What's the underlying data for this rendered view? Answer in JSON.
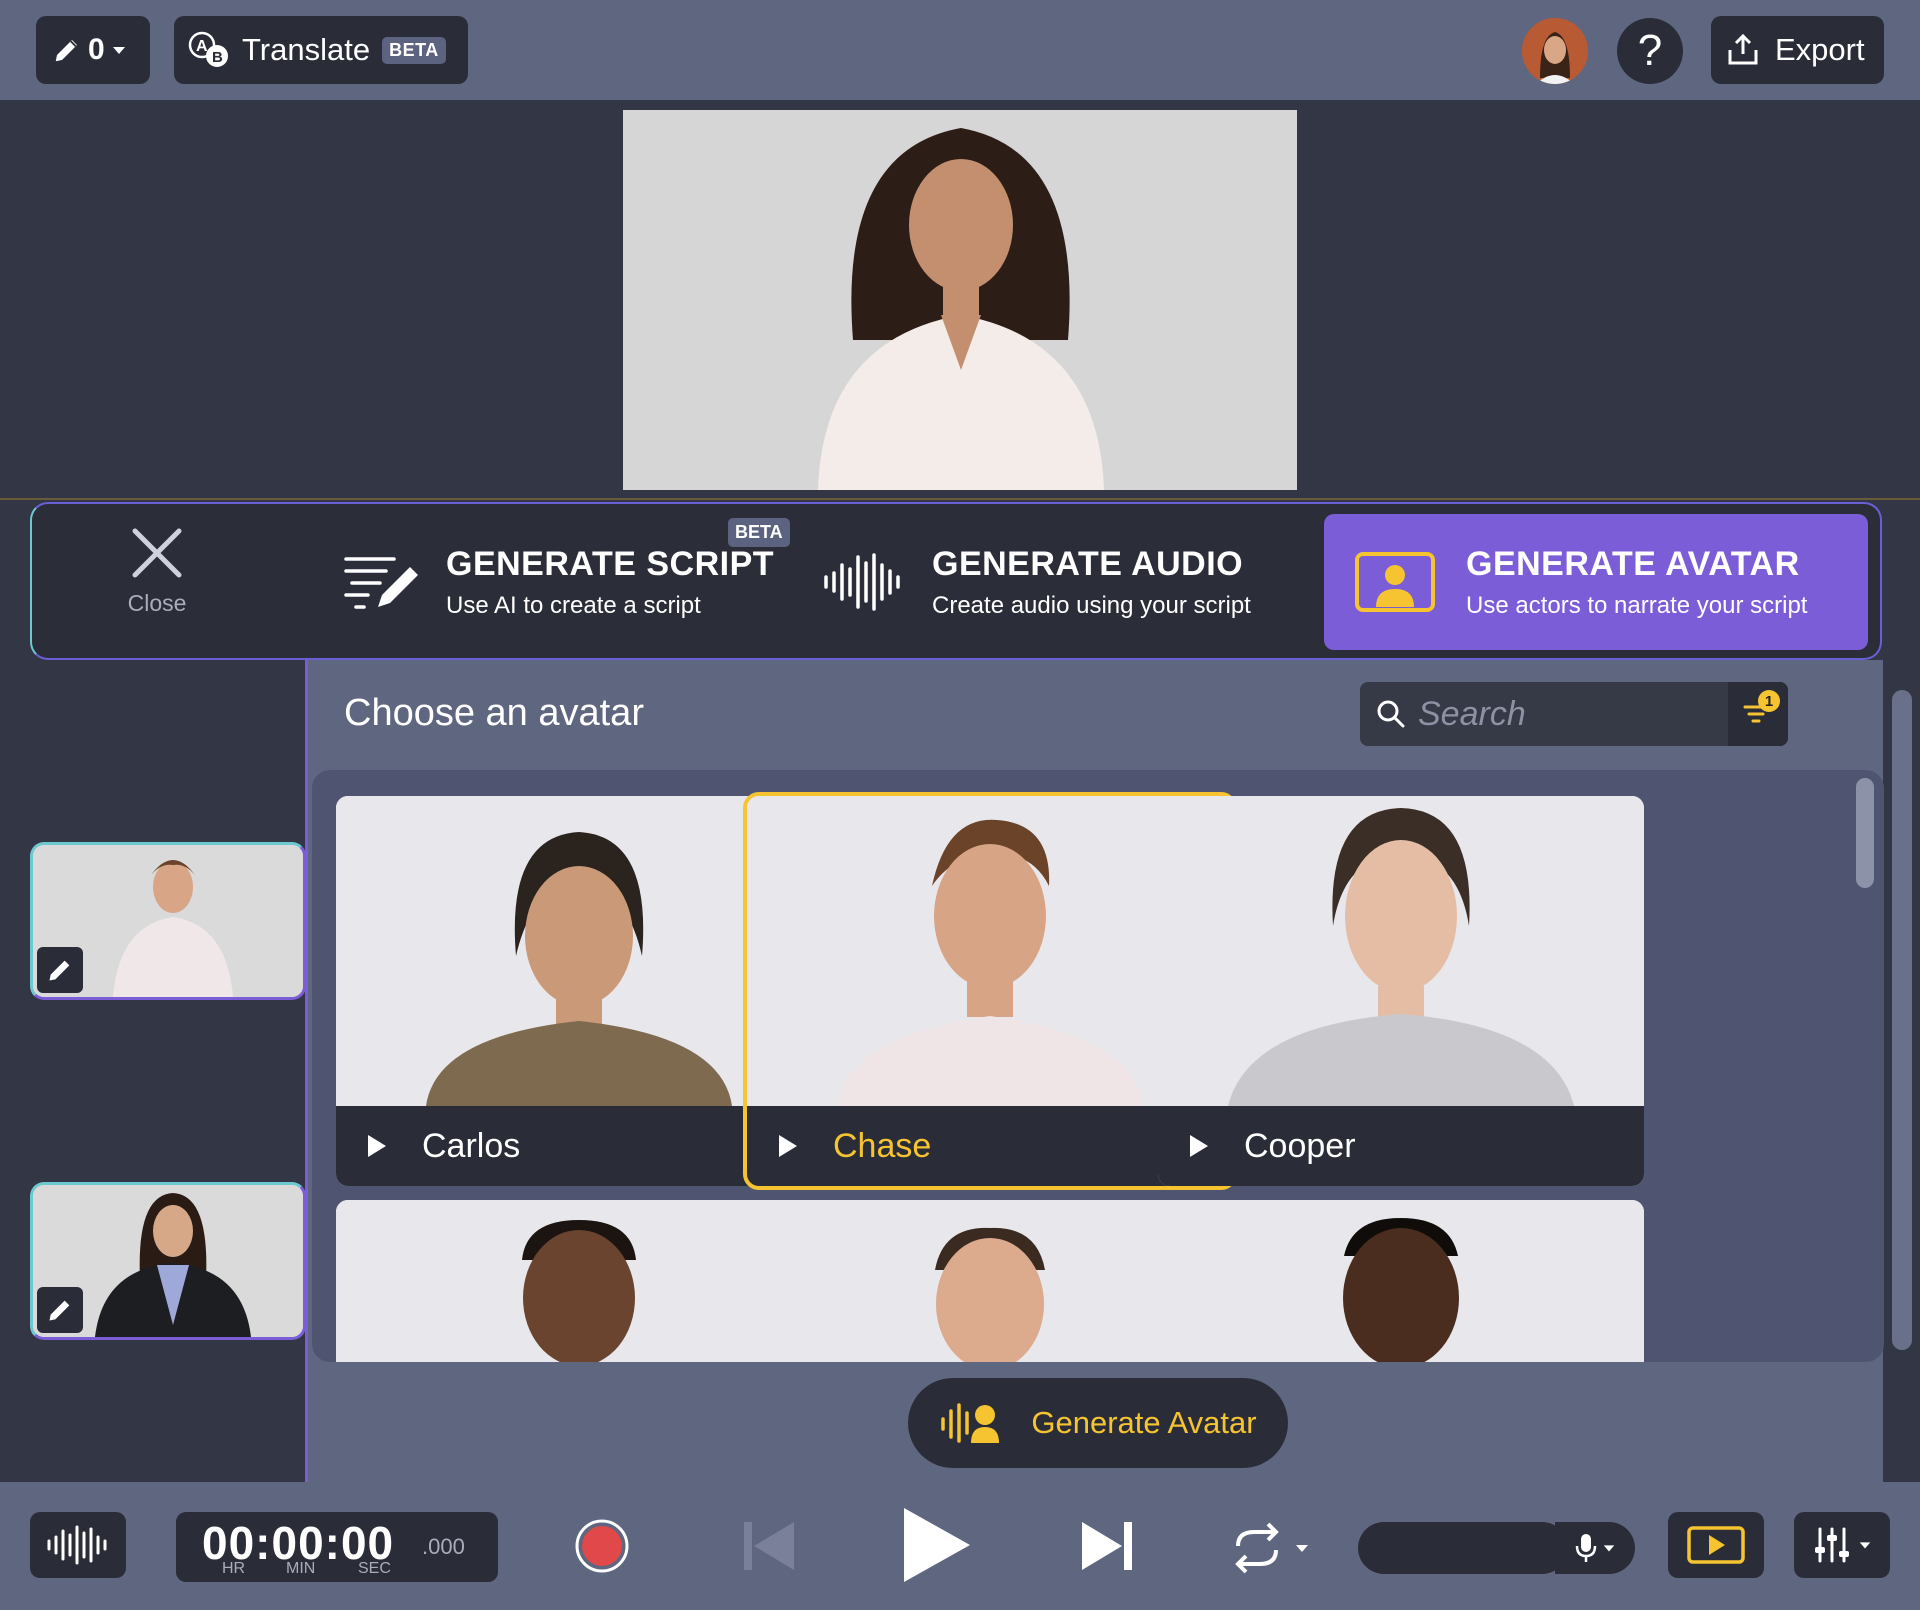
{
  "topbar": {
    "edit_count": "0",
    "translate_label": "Translate",
    "translate_badge": "BETA",
    "help_label": "?",
    "export_label": "Export"
  },
  "generate_panel": {
    "close_label": "Close",
    "tabs": [
      {
        "title": "GENERATE SCRIPT",
        "subtitle": "Use AI to create a script",
        "badge": "BETA"
      },
      {
        "title": "GENERATE AUDIO",
        "subtitle": "Create audio using your script"
      },
      {
        "title": "GENERATE AVATAR",
        "subtitle": "Use actors to narrate your script"
      }
    ],
    "active_tab": "GENERATE AVATAR"
  },
  "chooser": {
    "title": "Choose an avatar",
    "search_placeholder": "Search",
    "filter_count": "1",
    "avatars": [
      {
        "name": "Carlos",
        "selected": false
      },
      {
        "name": "Chase",
        "selected": true
      },
      {
        "name": "Cooper",
        "selected": false
      }
    ],
    "generate_button": "Generate Avatar"
  },
  "transport": {
    "timecode": "00:00:00",
    "milliseconds": ".000",
    "units": [
      "HR",
      "MIN",
      "SEC"
    ]
  },
  "colors": {
    "accent_purple": "#7b5dd8",
    "accent_yellow": "#f5c430",
    "bar_bg": "#5f6680",
    "dark_button": "#2a2d38",
    "record_red": "#e0484a"
  }
}
